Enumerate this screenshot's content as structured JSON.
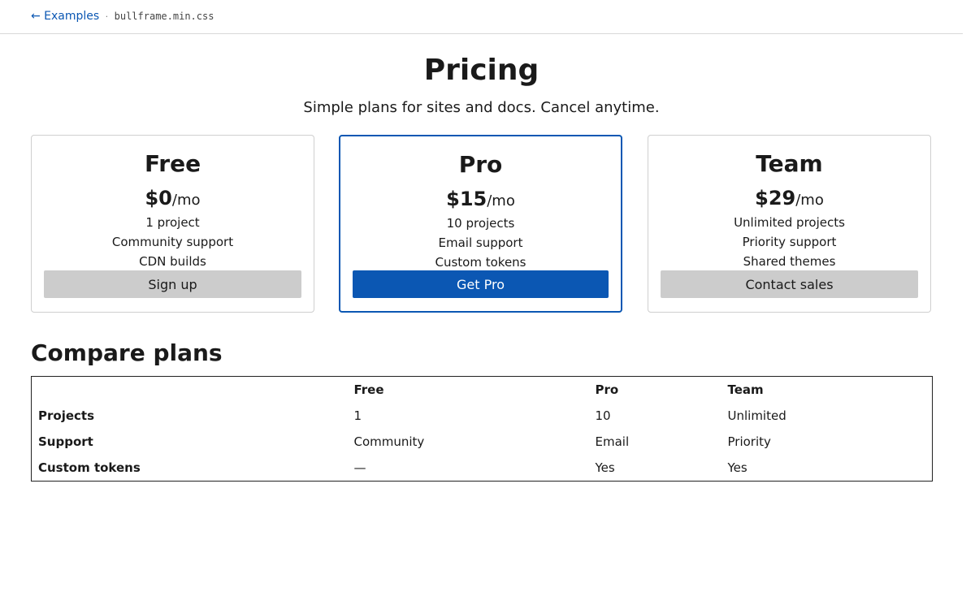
{
  "nav": {
    "back_label": "← Examples",
    "separator": "·",
    "filename": "bullframe.min.css"
  },
  "header": {
    "title": "Pricing",
    "subtitle": "Simple plans for sites and docs. Cancel anytime."
  },
  "plans": [
    {
      "name": "Free",
      "price": "$0",
      "period": "/mo",
      "features": [
        "1 project",
        "Community support",
        "CDN builds"
      ],
      "button": "Sign up"
    },
    {
      "name": "Pro",
      "price": "$15",
      "period": "/mo",
      "features": [
        "10 projects",
        "Email support",
        "Custom tokens"
      ],
      "button": "Get Pro"
    },
    {
      "name": "Team",
      "price": "$29",
      "period": "/mo",
      "features": [
        "Unlimited projects",
        "Priority support",
        "Shared themes"
      ],
      "button": "Contact sales"
    }
  ],
  "compare": {
    "title": "Compare plans",
    "headers": [
      "",
      "Free",
      "Pro",
      "Team"
    ],
    "rows": [
      [
        "Projects",
        "1",
        "10",
        "Unlimited"
      ],
      [
        "Support",
        "Community",
        "Email",
        "Priority"
      ],
      [
        "Custom tokens",
        "—",
        "Yes",
        "Yes"
      ]
    ]
  },
  "colors": {
    "accent": "#0b57b3",
    "secondary_button": "#cccccc",
    "card_border": "#cfcfcf"
  }
}
